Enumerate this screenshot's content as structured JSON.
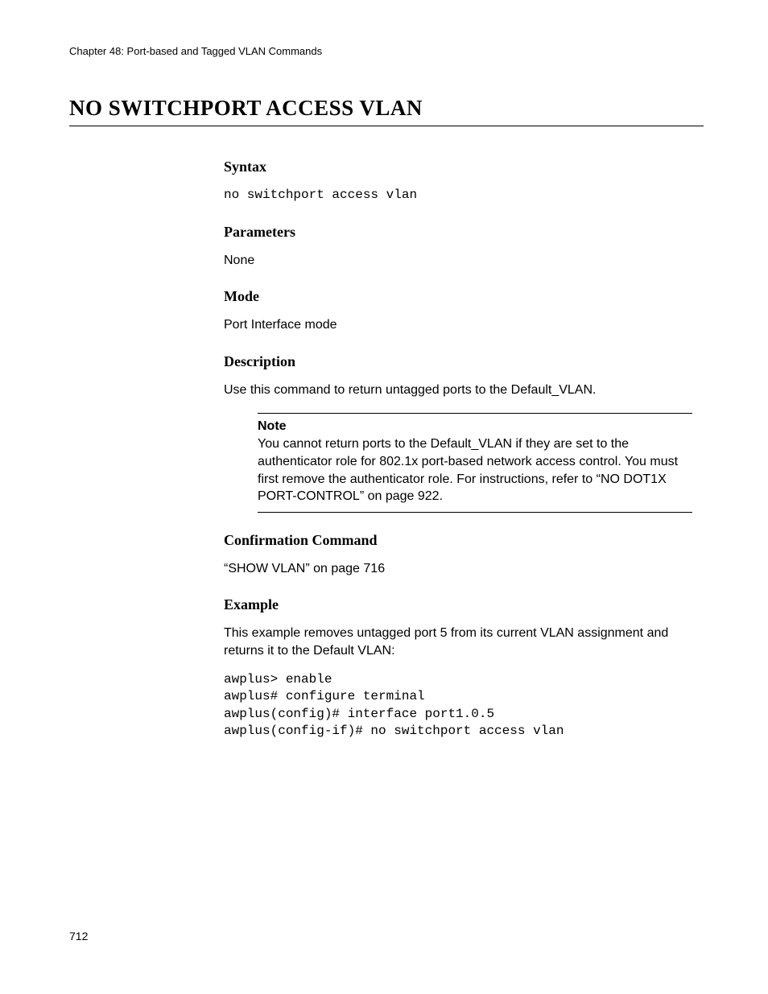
{
  "header": {
    "chapter": "Chapter 48: Port-based and Tagged VLAN Commands"
  },
  "title": "NO SWITCHPORT ACCESS VLAN",
  "sections": {
    "syntax": {
      "heading": "Syntax",
      "code": "no switchport access vlan"
    },
    "parameters": {
      "heading": "Parameters",
      "text": "None"
    },
    "mode": {
      "heading": "Mode",
      "text": "Port Interface mode"
    },
    "description": {
      "heading": "Description",
      "text": "Use this command to return untagged ports to the Default_VLAN."
    },
    "note": {
      "label": "Note",
      "body": "You cannot return ports to the Default_VLAN if they are set to the authenticator role for 802.1x port-based network access control. You must first remove the authenticator role. For instructions, refer to “NO DOT1X PORT-CONTROL” on page 922."
    },
    "confirmation": {
      "heading": "Confirmation Command",
      "text": "“SHOW VLAN” on page 716"
    },
    "example": {
      "heading": "Example",
      "text": "This example removes untagged port 5 from its current VLAN assignment and returns it to the Default VLAN:",
      "code": "awplus> enable\nawplus# configure terminal\nawplus(config)# interface port1.0.5\nawplus(config-if)# no switchport access vlan"
    }
  },
  "page_number": "712"
}
